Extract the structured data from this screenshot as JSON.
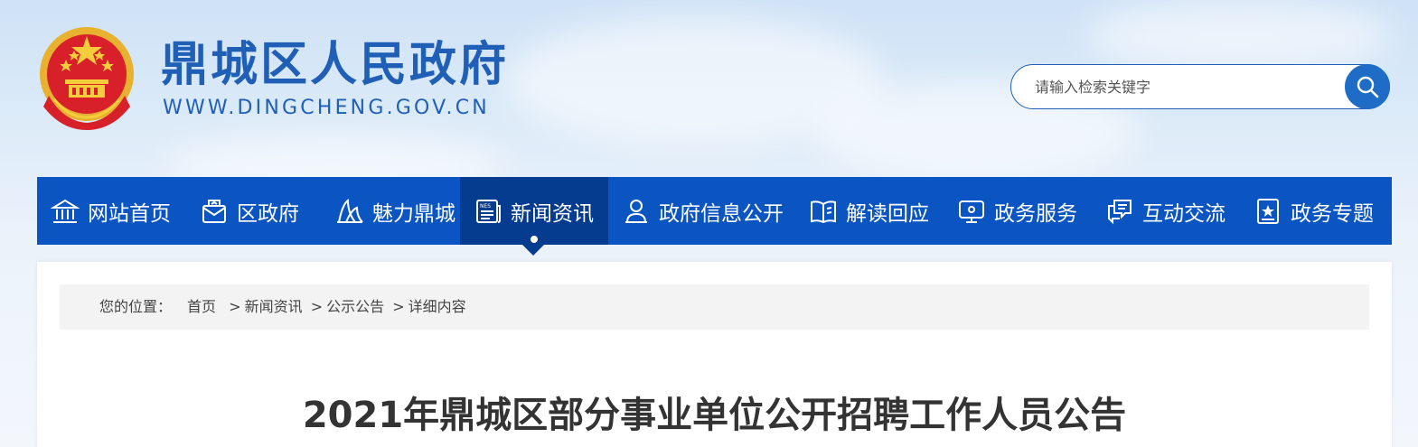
{
  "header": {
    "site_title": "鼎城区人民政府",
    "site_domain": "WWW.DINGCHENG.GOV.CN"
  },
  "search": {
    "placeholder": "请输入检索关键字"
  },
  "nav": {
    "items": [
      {
        "label": "网站首页",
        "icon": "museum-icon"
      },
      {
        "label": "区政府",
        "icon": "envelope-icon"
      },
      {
        "label": "魅力鼎城",
        "icon": "opera-house-icon"
      },
      {
        "label": "新闻资讯",
        "icon": "news-icon",
        "active": true
      },
      {
        "label": "政府信息公开",
        "icon": "person-icon"
      },
      {
        "label": "解读回应",
        "icon": "book-icon"
      },
      {
        "label": "政务服务",
        "icon": "monitor-icon"
      },
      {
        "label": "互动交流",
        "icon": "chat-icon"
      },
      {
        "label": "政务专题",
        "icon": "star-board-icon"
      }
    ]
  },
  "breadcrumb": {
    "prefix": "您的位置：",
    "items": [
      "首页",
      "新闻资讯",
      "公示公告",
      "详细内容"
    ]
  },
  "article": {
    "title": "2021年鼎城区部分事业单位公开招聘工作人员公告"
  },
  "colors": {
    "brand_blue": "#1f5fb5",
    "nav_bg": "#0b55c2",
    "nav_active": "#063c8f"
  }
}
